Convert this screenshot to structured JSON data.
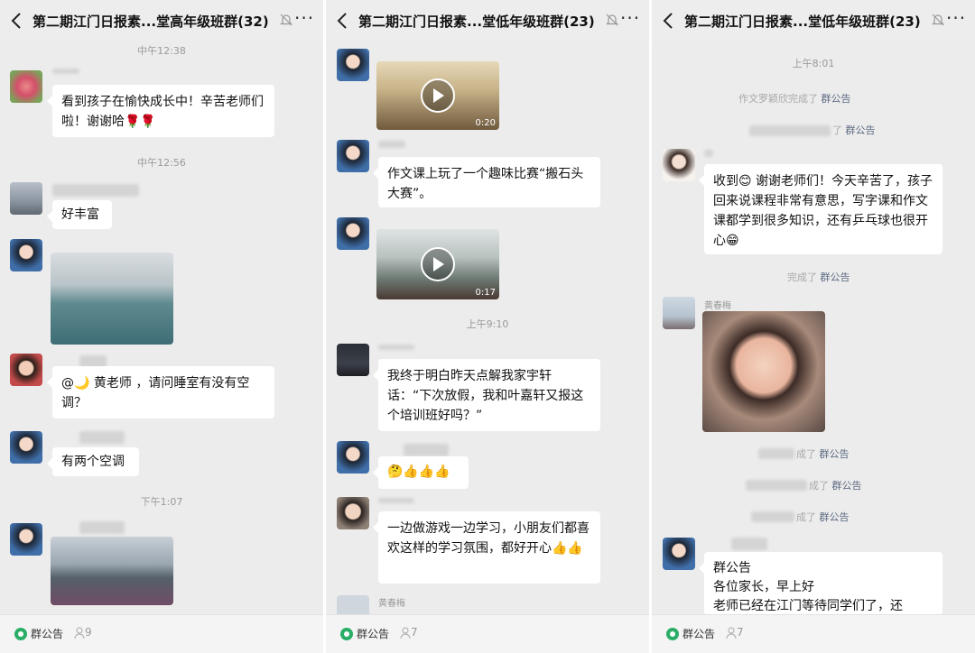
{
  "panels": [
    {
      "title": "第二期江门日报素...堂高年级班群(32)",
      "times": [
        "中午12:38",
        "中午12:56",
        "下午1:07"
      ],
      "messages": [
        "看到孩子在愉快成长中！辛苦老师们啦！谢谢哈🌹🌹",
        "好丰富",
        "@🌙 黄老师 ，请问睡室有没有空调？",
        "有两个空调"
      ],
      "footer": {
        "notice": "群公告",
        "count": "9"
      }
    },
    {
      "title": "第二期江门日报素...堂低年级班群(23)",
      "times": [
        "上午9:10"
      ],
      "video_durations": [
        "0:20",
        "0:17"
      ],
      "messages": [
        "作文课上玩了一个趣味比赛“搬石头大赛”。",
        "我终于明白昨天点解我家宇轩话：“下次放假，我和叶嘉轩又报这个培训班好吗？”",
        "🤔👍👍👍",
        "一边做游戏一边学习，小朋友们都喜欢这样的学习氛围，都好开心👍👍"
      ],
      "names": [
        "黄春梅"
      ],
      "footer": {
        "notice": "群公告",
        "count": "7"
      }
    },
    {
      "title": "第二期江门日报素...堂低年级班群(23)",
      "times": [
        "上午8:01"
      ],
      "system": [
        {
          "text": "作文罗颖欣完成了 ",
          "hl": "群公告"
        },
        {
          "text": "了 ",
          "hl": "群公告"
        },
        {
          "text": "完成了 ",
          "hl": "群公告"
        },
        {
          "text": "成了 ",
          "hl": "群公告"
        },
        {
          "text": "成了 ",
          "hl": "群公告"
        },
        {
          "text": "成了 ",
          "hl": "群公告"
        }
      ],
      "messages": [
        "收到😊 谢谢老师们！今天辛苦了，孩子回来说课程非常有意思，写字课和作文课都学到很多知识，还有乒乓球也很开心😁",
        "群公告\n各位家长，早上好\n老师已经在江门等待同学们了，还"
      ],
      "names": [
        "黄春梅"
      ],
      "footer": {
        "notice": "群公告",
        "count": "7"
      }
    }
  ],
  "colors": {
    "panel_bg": "#ececec",
    "bubble": "#ffffff",
    "notice_green": "#2aae67",
    "link": "#5c6a82"
  }
}
